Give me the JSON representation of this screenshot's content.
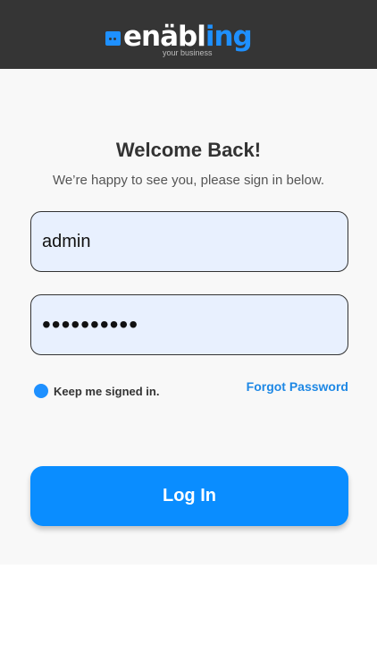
{
  "header": {
    "logo": {
      "brand_white": "enäbl",
      "brand_blue": "ing",
      "tagline": "your business"
    }
  },
  "login": {
    "title": "Welcome Back!",
    "subtitle": "We’re happy to see you, please sign in below.",
    "username_value": "admin",
    "password_value": "••••••••••",
    "remember_label": "Keep me signed in.",
    "forgot_label": "Forgot Password",
    "submit_label": "Log In"
  },
  "colors": {
    "header_bg": "#353535",
    "accent": "#0a8dff",
    "field_bg": "#e8f0fe",
    "page_bg": "#f8f8f8"
  }
}
